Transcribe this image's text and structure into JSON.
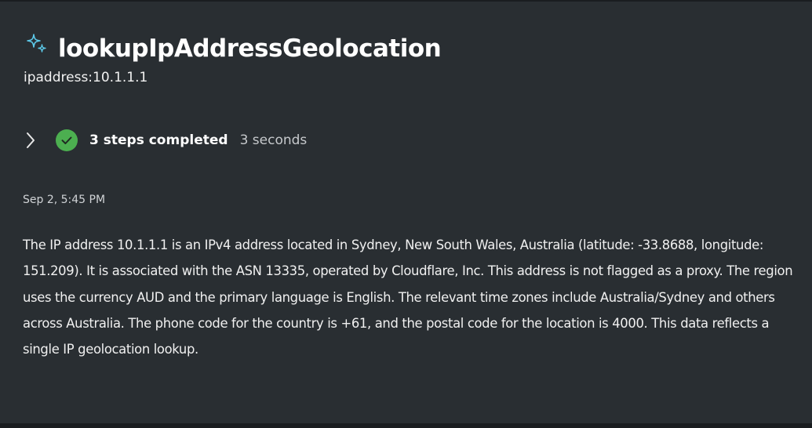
{
  "header": {
    "icon": "sparkle-icon",
    "title": "lookupIpAddressGeolocation",
    "subtitle": "ipaddress:10.1.1.1"
  },
  "steps": {
    "expand_icon": "chevron-right-icon",
    "status_icon": "check-circle-icon",
    "label": "3 steps completed",
    "duration": "3 seconds"
  },
  "message": {
    "timestamp": "Sep 2, 5:45 PM",
    "text": "The IP address 10.1.1.1 is an IPv4 address located in Sydney, New South Wales, Australia (latitude: -33.8688, longitude: 151.209). It is associated with the ASN 13335, operated by Cloudflare, Inc. This address is not flagged as a proxy. The region uses the currency AUD and the primary language is English. The relevant time zones include Australia/Sydney and others across Australia. The phone code for the country is +61, and the postal code for the location is 4000. This data reflects a single IP geolocation lookup."
  },
  "colors": {
    "background": "#292e32",
    "accent_sparkle": "#5cc8e8",
    "success": "#4caf50"
  }
}
